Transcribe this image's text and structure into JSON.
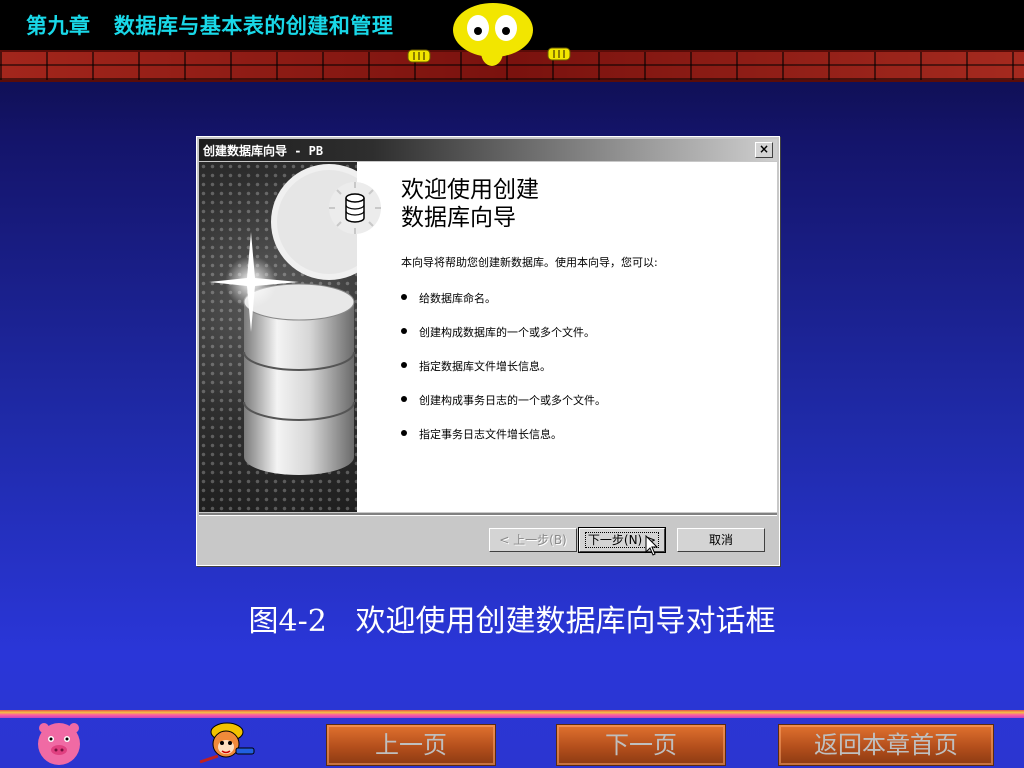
{
  "header": {
    "chapter_title": "第九章   数据库与基本表的创建和管理",
    "colors": {
      "title": "#19d8e8",
      "brick": "#8a1a14",
      "mascot": "#ffe800"
    }
  },
  "dialog": {
    "title": "创建数据库向导 - PB",
    "close_glyph": "×",
    "heading_line1": "欢迎使用创建",
    "heading_line2": "数据库向导",
    "intro": "本向导将帮助您创建新数据库。使用本向导，您可以:",
    "items": [
      "给数据库命名。",
      "创建构成数据库的一个或多个文件。",
      "指定数据库文件增长信息。",
      "创建构成事务日志的一个或多个文件。",
      "指定事务日志文件增长信息。"
    ],
    "buttons": {
      "back": "< 上一步(B)",
      "next": "下一步(N) >",
      "cancel": "取消"
    },
    "icons": {
      "hero": "database-cylinder-icon",
      "badge": "database-icon",
      "cursor": "mouse-cursor-icon"
    }
  },
  "caption": "图4-2   欢迎使用创建数据库向导对话框",
  "footer": {
    "prev": "上一页",
    "next": "下一页",
    "home": "返回本章首页",
    "icons": {
      "left": "pig-face-icon",
      "right": "monkey-king-icon"
    }
  }
}
